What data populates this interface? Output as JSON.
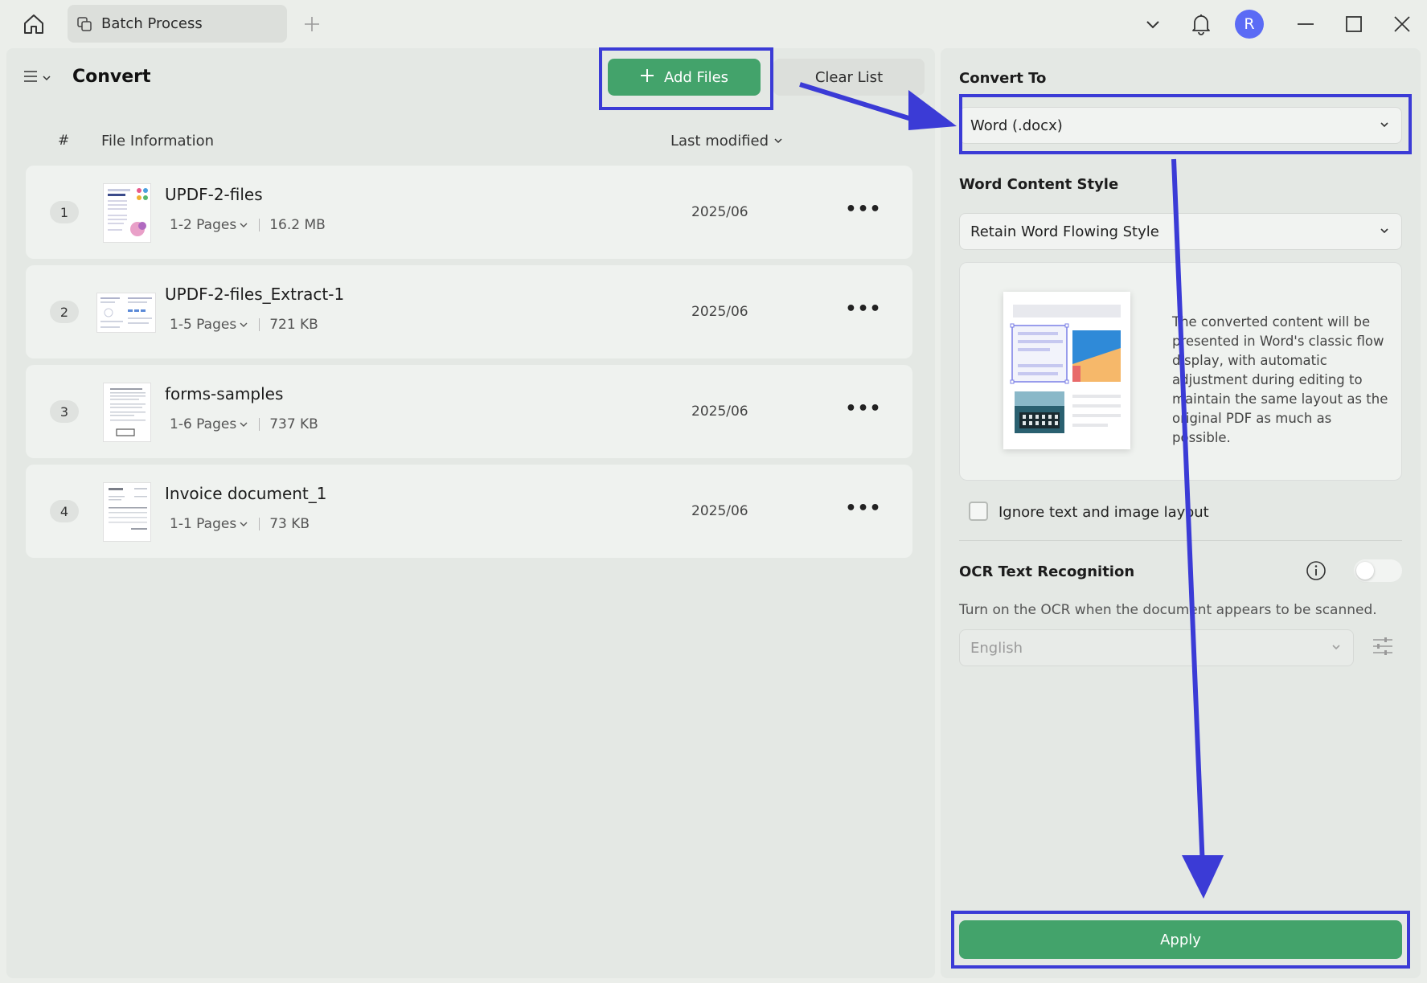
{
  "tab": {
    "label": "Batch Process"
  },
  "left": {
    "title": "Convert",
    "add_files": "Add Files",
    "clear_list": "Clear List",
    "columns": {
      "hash": "#",
      "info": "File Information",
      "modified": "Last modified"
    },
    "files": [
      {
        "num": "1",
        "name": "UPDF-2-files",
        "pages": "1-2 Pages",
        "size": "16.2 MB",
        "date": "2025/06"
      },
      {
        "num": "2",
        "name": "UPDF-2-files_Extract-1",
        "pages": "1-5 Pages",
        "size": "721 KB",
        "date": "2025/06"
      },
      {
        "num": "3",
        "name": "forms-samples",
        "pages": "1-6 Pages",
        "size": "737 KB",
        "date": "2025/06"
      },
      {
        "num": "4",
        "name": "Invoice document_1",
        "pages": "1-1 Pages",
        "size": "73 KB",
        "date": "2025/06"
      }
    ]
  },
  "right": {
    "convert_to_label": "Convert To",
    "convert_to_value": "Word (.docx)",
    "style_label": "Word Content Style",
    "style_value": "Retain Word Flowing Style",
    "style_description": "The converted content will be presented in Word's classic flow display, with automatic adjustment during editing to maintain the same layout as the original PDF as much as possible.",
    "ignore_layout": "Ignore text and image layout",
    "ocr_label": "OCR Text Recognition",
    "ocr_description": "Turn on the OCR when the document appears to be scanned.",
    "ocr_language": "English",
    "apply": "Apply"
  },
  "user": {
    "avatar_initial": "R"
  },
  "colors": {
    "accent_green": "#43a36b",
    "annotation_blue": "#3b3bd6",
    "avatar_blue": "#5b6bf5"
  }
}
